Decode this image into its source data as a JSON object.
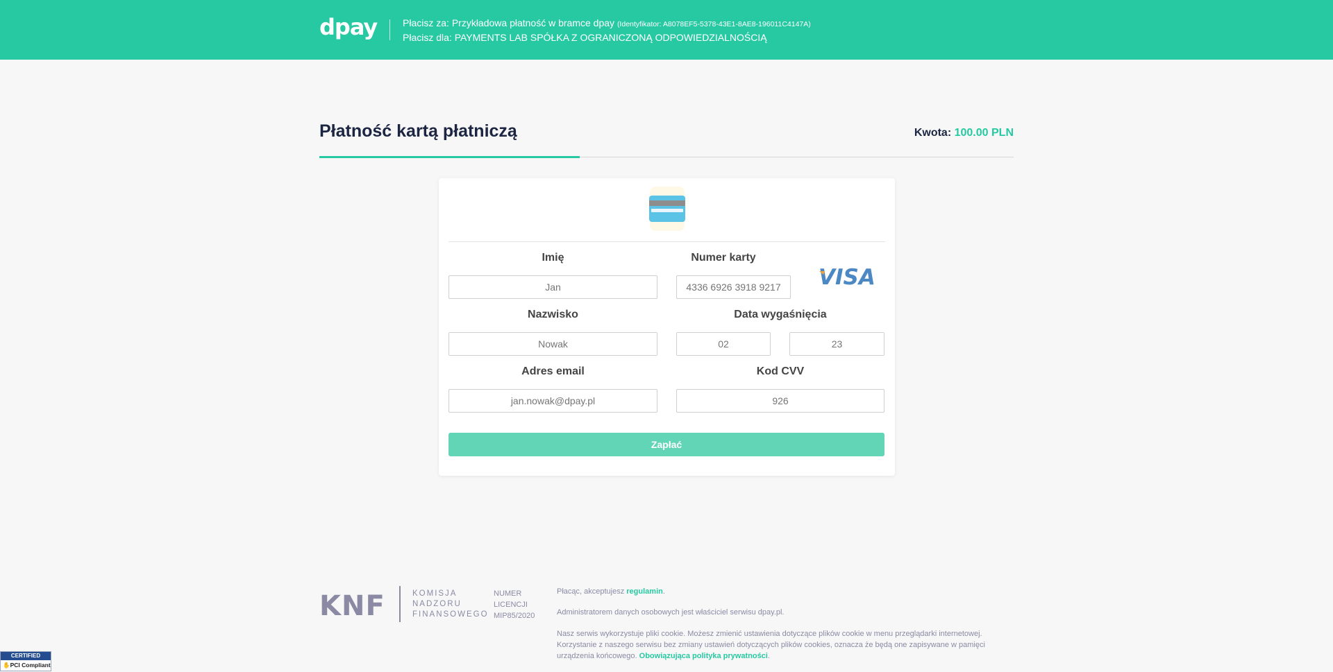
{
  "header": {
    "logo": "dpay",
    "payee_line_prefix": "Płacisz za: ",
    "payment_title": "Przykładowa płatność w bramce dpay",
    "identifier": "(Identyfikator: A8078EF5-5378-43E1-8AE8-196011C4147A)",
    "recipient_line": "Płacisz dla: PAYMENTS LAB SPÓŁKA Z OGRANICZONĄ ODPOWIEDZIALNOŚCIĄ"
  },
  "page": {
    "title": "Płatność kartą płatniczą",
    "amount_label": "Kwota:",
    "amount_value": "100.00 PLN"
  },
  "form": {
    "first_name_label": "Imię",
    "first_name_placeholder": "Jan",
    "card_number_label": "Numer karty",
    "card_number_placeholder": "4336 6926 3918 9217",
    "card_brand": "VISA",
    "last_name_label": "Nazwisko",
    "last_name_placeholder": "Nowak",
    "expiry_label": "Data wygaśnięcia",
    "expiry_month_placeholder": "02",
    "expiry_year_placeholder": "23",
    "email_label": "Adres email",
    "email_placeholder": "jan.nowak@dpay.pl",
    "cvv_label": "Kod CVV",
    "cvv_placeholder": "926",
    "pay_button": "Zapłać"
  },
  "footer": {
    "knf_logo": "KNF",
    "knf_name_1": "KOMISJA",
    "knf_name_2": "NADZORU",
    "knf_name_3": "FINANSOWEGO",
    "license_1": "NUMER",
    "license_2": "LICENCJI",
    "license_3": "MIP85/2020",
    "terms_prefix": "Płacąc, akceptujesz ",
    "terms_link": "regulamin",
    "terms_suffix": ".",
    "admin_text": "Administratorem danych osobowych jest właściciel serwisu dpay.pl.",
    "cookies_text": "Nasz serwis wykorzystuje pliki cookie. Możesz zmienić ustawienia dotyczące plików cookie w menu przeglądarki internetowej. Korzystanie z naszego serwisu bez zmiany ustawień dotyczących plików cookies, oznacza że będą one zapisywane w pamięci urządzenia końcowego. ",
    "privacy_link": "Obowiązująca polityka prywatności",
    "privacy_suffix": "."
  },
  "badge": {
    "top": "CERTIFIED",
    "bottom": "PCI Compliant"
  },
  "colors": {
    "accent": "#27c9a2",
    "button": "#62d5b7",
    "title": "#1c2541",
    "footer_text": "#8a8aa5"
  }
}
